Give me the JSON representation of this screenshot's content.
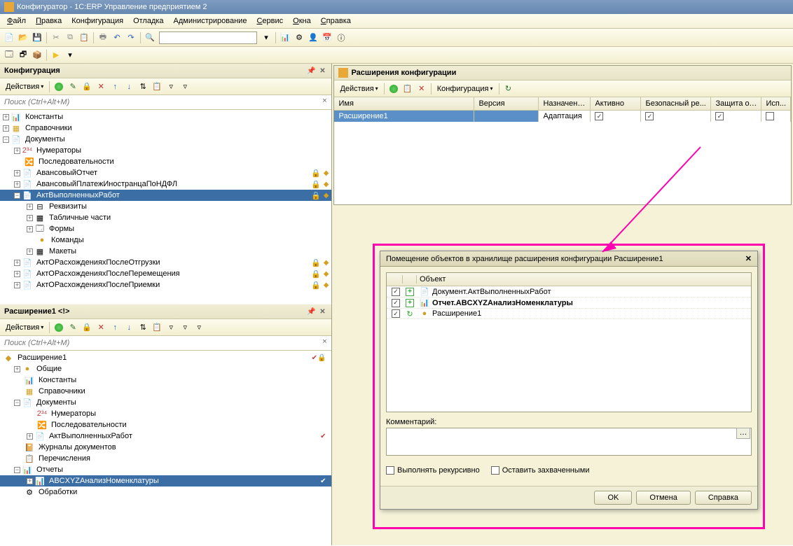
{
  "title": "Конфигуратор - 1С:ERP Управление предприятием 2",
  "menu": {
    "file": "Файл",
    "edit": "Правка",
    "config": "Конфигурация",
    "debug": "Отладка",
    "admin": "Администрирование",
    "service": "Сервис",
    "windows": "Окна",
    "help": "Справка"
  },
  "panels": {
    "config": {
      "title": "Конфигурация",
      "actions": "Действия",
      "search_ph": "Поиск (Ctrl+Alt+M)"
    },
    "extension": {
      "title": "Расширение1 <!>",
      "actions": "Действия",
      "search_ph": "Поиск (Ctrl+Alt+M)"
    }
  },
  "config_tree": {
    "constants": "Константы",
    "catalogs": "Справочники",
    "documents": "Документы",
    "numerators": "Нумераторы",
    "sequences": "Последовательности",
    "advance": "АвансовыйОтчет",
    "advpay": "АвансовыйПлатежИностранцаПоНДФЛ",
    "akt": "АктВыполненныхРабот",
    "requisites": "Реквизиты",
    "tabparts": "Табличные части",
    "forms": "Формы",
    "commands": "Команды",
    "layouts": "Макеты",
    "disc1": "АктОРасхожденияхПослеОтгрузки",
    "disc2": "АктОРасхожденияхПослеПеремещения",
    "disc3": "АктОРасхожденияхПослеПриемки"
  },
  "ext_tree": {
    "root": "Расширение1",
    "common": "Общие",
    "constants": "Константы",
    "catalogs": "Справочники",
    "documents": "Документы",
    "numerators": "Нумераторы",
    "sequences": "Последовательности",
    "akt": "АктВыполненныхРабот",
    "journals": "Журналы документов",
    "enums": "Перечисления",
    "reports": "Отчеты",
    "abc": "ABCXYZАнализНоменклатуры",
    "processing": "Обработки"
  },
  "ext_panel": {
    "title": "Расширения конфигурации",
    "actions": "Действия",
    "config_btn": "Конфигурация",
    "cols": {
      "name": "Имя",
      "version": "Версия",
      "purpose": "Назначение",
      "active": "Активно",
      "safe": "Безопасный ре...",
      "protect": "Защита от...",
      "use": "Исп..."
    },
    "row": {
      "name": "Расширение1",
      "purpose": "Адаптация"
    }
  },
  "dialog": {
    "title": "Помещение объектов в хранилище расширения конфигурации Расширение1",
    "obj_col": "Объект",
    "rows": {
      "r1": "Документ.АктВыполненныхРабот",
      "r2": "Отчет.ABCXYZАнализНоменклатуры",
      "r3": "Расширение1"
    },
    "comment": "Комментарий:",
    "recursive": "Выполнять рекурсивно",
    "keep": "Оставить захваченными",
    "ok": "OK",
    "cancel": "Отмена",
    "help": "Справка"
  }
}
